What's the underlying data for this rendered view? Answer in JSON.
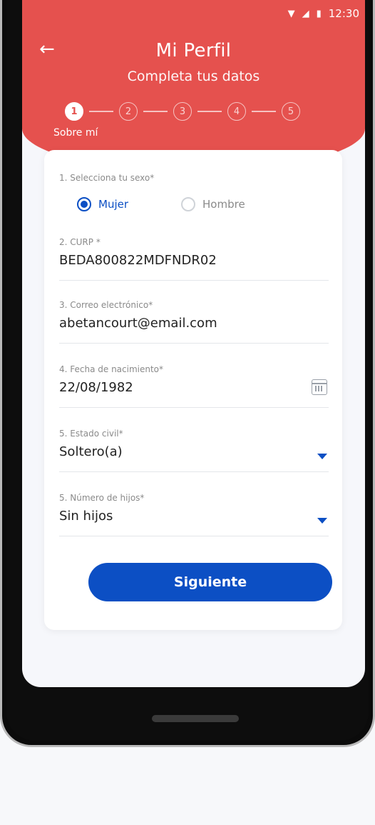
{
  "status": {
    "time": "12:30"
  },
  "header": {
    "title": "Mi Perfil",
    "subtitle": "Completa tus datos",
    "steps": [
      "1",
      "2",
      "3",
      "4",
      "5"
    ],
    "current_step_label": "Sobre mí"
  },
  "form": {
    "sex": {
      "label": "1. Selecciona tu sexo*",
      "options": [
        "Mujer",
        "Hombre"
      ],
      "selected": "Mujer"
    },
    "curp": {
      "label": "2. CURP *",
      "value": "BEDA800822MDFNDR02"
    },
    "email": {
      "label": "3. Correo electrónico*",
      "value": "abetancourt@email.com"
    },
    "birthdate": {
      "label": "4. Fecha de nacimiento*",
      "value": "22/08/1982"
    },
    "civil_status": {
      "label": "5. Estado civil*",
      "value": "Soltero(a)"
    },
    "children": {
      "label": "5. Número de hijos*",
      "value": "Sin hijos"
    },
    "next_label": "Siguiente"
  },
  "colors": {
    "header": "#e5514e",
    "primary": "#0c4fc4"
  }
}
